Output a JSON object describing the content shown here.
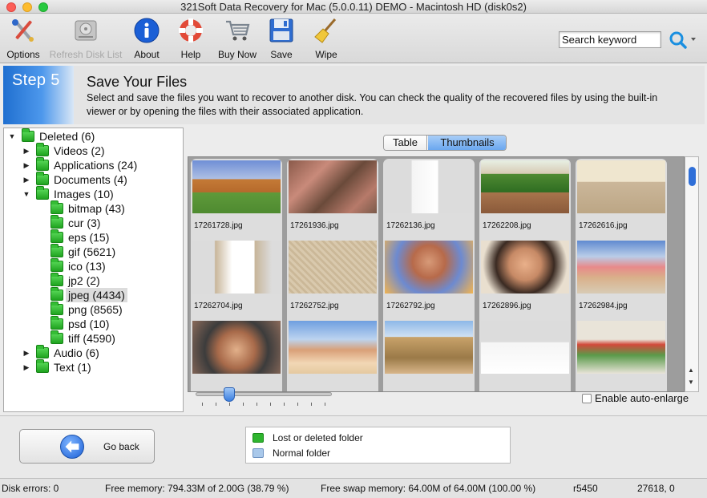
{
  "window": {
    "title": "321Soft Data Recovery for Mac (5.0.0.11) DEMO - Macintosh HD (disk0s2)"
  },
  "toolbar": {
    "options": "Options",
    "refresh": "Refresh Disk List",
    "about": "About",
    "help": "Help",
    "buy": "Buy Now",
    "save": "Save",
    "wipe": "Wipe",
    "search_placeholder": "Search keyword"
  },
  "step": {
    "badge": "Step 5",
    "title": "Save Your Files",
    "description": "Select and save the files you want to recover to another disk. You can check the quality of the recovered files by using the built-in viewer or by opening the files with their associated application."
  },
  "tree": {
    "nodes": [
      {
        "label": "Deleted (6)",
        "level": 0,
        "expanded": true
      },
      {
        "label": "Videos (2)",
        "level": 1,
        "expanded": false
      },
      {
        "label": "Applications (24)",
        "level": 1,
        "expanded": false
      },
      {
        "label": "Documents (4)",
        "level": 1,
        "expanded": false
      },
      {
        "label": "Images (10)",
        "level": 1,
        "expanded": true
      },
      {
        "label": "bitmap (43)",
        "level": 2
      },
      {
        "label": "cur (3)",
        "level": 2
      },
      {
        "label": "eps (15)",
        "level": 2
      },
      {
        "label": "gif (5621)",
        "level": 2
      },
      {
        "label": "ico (13)",
        "level": 2
      },
      {
        "label": "jp2 (2)",
        "level": 2
      },
      {
        "label": "jpeg (4434)",
        "level": 2,
        "selected": true
      },
      {
        "label": "png (8565)",
        "level": 2
      },
      {
        "label": "psd (10)",
        "level": 2
      },
      {
        "label": "tiff (4590)",
        "level": 2
      },
      {
        "label": "Audio (6)",
        "level": 1,
        "expanded": false
      },
      {
        "label": "Text (1)",
        "level": 1,
        "expanded": false
      }
    ]
  },
  "view": {
    "tabs": [
      "Table",
      "Thumbnails"
    ],
    "active_tab": "Thumbnails",
    "auto_enlarge": "Enable auto-enlarge",
    "thumbnails": [
      "17261728.jpg",
      "17261936.jpg",
      "17262136.jpg",
      "17262208.jpg",
      "17262616.jpg",
      "17262704.jpg",
      "17262752.jpg",
      "17262792.jpg",
      "17262896.jpg",
      "17262984.jpg",
      "",
      "",
      "",
      "",
      ""
    ]
  },
  "bottom": {
    "go_back": "Go back",
    "legend": [
      {
        "label": "Lost or deleted folder",
        "color": "#2fb52f"
      },
      {
        "label": "Normal folder",
        "color": "#a9c8ea"
      }
    ]
  },
  "status": {
    "disk_errors": "Disk errors: 0",
    "free_memory": "Free memory: 794.33M of 2.00G (38.79 %)",
    "free_swap": "Free swap memory: 64.00M of 64.00M (100.00 %)",
    "revision": "r5450",
    "coords": "27618, 0"
  }
}
